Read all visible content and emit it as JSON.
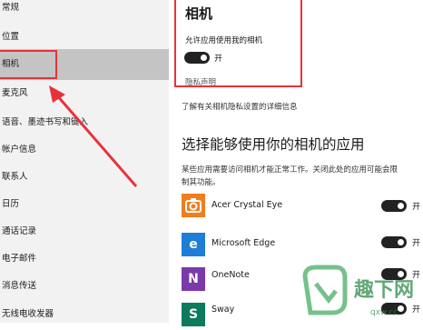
{
  "sidebar": {
    "items": [
      {
        "label": "常规"
      },
      {
        "label": "位置"
      },
      {
        "label": "相机"
      },
      {
        "label": "麦克风"
      },
      {
        "label": "语音、墨迹书写和键入"
      },
      {
        "label": "帐户信息"
      },
      {
        "label": "联系人"
      },
      {
        "label": "日历"
      },
      {
        "label": "通话记录"
      },
      {
        "label": "电子邮件"
      },
      {
        "label": "消息传送"
      },
      {
        "label": "无线电收发器"
      }
    ],
    "selected_index": 2
  },
  "camera": {
    "title": "相机",
    "allow_label": "允许应用使用我的相机",
    "toggle_on": true,
    "toggle_state": "开",
    "privacy_link": "隐私声明"
  },
  "learn_more": "了解有关相机隐私设置的详细信息",
  "apps": {
    "heading": "选择能够使用你的相机的应用",
    "description_line1": "某些应用需要访问相机才能正常工作。关闭此处的应用可能会限",
    "description_line2": "制其功能。",
    "list": [
      {
        "name": "Acer Crystal Eye",
        "icon": "camera-icon",
        "color": "#f07d1e",
        "state": "开",
        "on": true
      },
      {
        "name": "Microsoft Edge",
        "icon": "edge-icon",
        "color": "#1e7dd8",
        "state": "开",
        "on": true
      },
      {
        "name": "OneNote",
        "icon": "onenote-icon",
        "color": "#7b3aa9",
        "state": "开",
        "on": true
      },
      {
        "name": "Sway",
        "icon": "sway-icon",
        "color": "#0b7a5d",
        "state": "开",
        "on": true
      }
    ]
  },
  "watermark": {
    "brand": "趣下网",
    "url": "qxw.cc"
  },
  "colors": {
    "highlight": "#e8323a",
    "selected_bg": "#c4c4c4",
    "sidebar_bg": "#f2f2f2",
    "toggle_on": "#222222"
  }
}
